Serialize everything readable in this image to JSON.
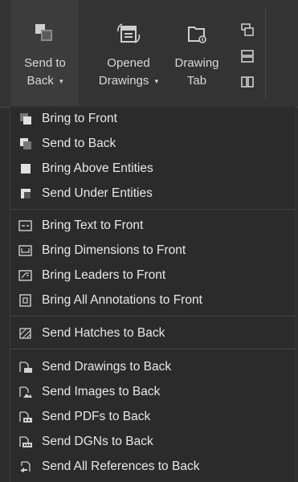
{
  "ribbon": {
    "send_to_back": {
      "line1": "Send to",
      "line2": "Back",
      "caret": "▾",
      "icon": "send-to-back-icon"
    },
    "opened_drawings": {
      "line1": "Opened",
      "line2": "Drawings",
      "caret": "▾",
      "icon": "opened-drawings-icon"
    },
    "drawing_tab": {
      "line1": "Drawing",
      "line2": "Tab",
      "icon": "drawing-tab-icon"
    },
    "small_buttons": [
      {
        "icon": "cascade-windows-icon"
      },
      {
        "icon": "tile-horizontal-icon"
      },
      {
        "icon": "tile-vertical-icon"
      }
    ]
  },
  "menu": {
    "groups": [
      [
        {
          "label": "Bring to Front",
          "icon": "bring-to-front-icon"
        },
        {
          "label": "Send to Back",
          "icon": "send-to-back-icon"
        },
        {
          "label": "Bring Above Entities",
          "icon": "bring-above-entities-icon"
        },
        {
          "label": "Send Under Entities",
          "icon": "send-under-entities-icon"
        }
      ],
      [
        {
          "label": "Bring Text to Front",
          "icon": "text-to-front-icon"
        },
        {
          "label": "Bring Dimensions to Front",
          "icon": "dimensions-to-front-icon"
        },
        {
          "label": "Bring Leaders to Front",
          "icon": "leaders-to-front-icon"
        },
        {
          "label": "Bring All Annotations to Front",
          "icon": "annotations-to-front-icon"
        }
      ],
      [
        {
          "label": "Send Hatches to Back",
          "icon": "hatches-to-back-icon"
        }
      ],
      [
        {
          "label": "Send Drawings to Back",
          "icon": "drawings-to-back-icon"
        },
        {
          "label": "Send Images to Back",
          "icon": "images-to-back-icon"
        },
        {
          "label": "Send PDFs to Back",
          "icon": "pdfs-to-back-icon"
        },
        {
          "label": "Send DGNs to Back",
          "icon": "dgns-to-back-icon"
        },
        {
          "label": "Send All References to Back",
          "icon": "references-to-back-icon"
        }
      ]
    ]
  }
}
